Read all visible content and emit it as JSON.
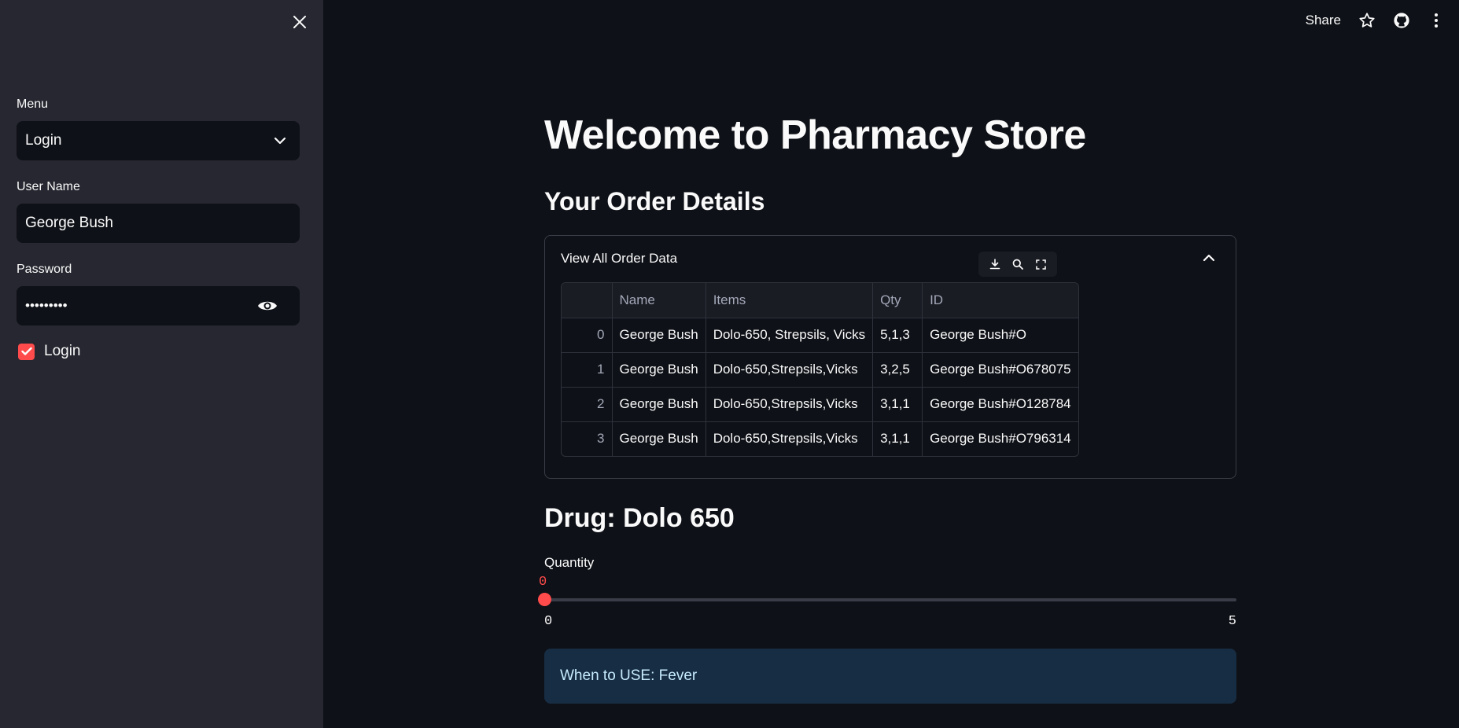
{
  "sidebar": {
    "menu_label": "Menu",
    "menu_value": "Login",
    "username_label": "User Name",
    "username_value": "George Bush",
    "password_label": "Password",
    "password_value": "•••••••••",
    "checkbox_label": "Login",
    "checkbox_checked": true
  },
  "topbar": {
    "share_label": "Share"
  },
  "main": {
    "title": "Welcome to Pharmacy Store",
    "subtitle": "Your Order Details",
    "expander_label": "View All Order Data",
    "table": {
      "columns": [
        "",
        "Name",
        "Items",
        "Qty",
        "ID"
      ],
      "rows": [
        [
          "0",
          "George Bush",
          "Dolo-650, Strepsils, Vicks",
          "5,1,3",
          "George Bush#O"
        ],
        [
          "1",
          "George Bush",
          "Dolo-650,Strepsils,Vicks",
          "3,2,5",
          "George Bush#O678075"
        ],
        [
          "2",
          "George Bush",
          "Dolo-650,Strepsils,Vicks",
          "3,1,1",
          "George Bush#O128784"
        ],
        [
          "3",
          "George Bush",
          "Dolo-650,Strepsils,Vicks",
          "3,1,1",
          "George Bush#O796314"
        ]
      ]
    },
    "drug_heading": "Drug: Dolo 650",
    "quantity_label": "Quantity",
    "slider": {
      "value": "0",
      "min": "0",
      "max": "5"
    },
    "info_text": "When to USE: Fever"
  },
  "colors": {
    "accent": "#ff4b4b",
    "background": "#0e1117",
    "sidebar": "#262730",
    "info_bg": "#172d43"
  }
}
